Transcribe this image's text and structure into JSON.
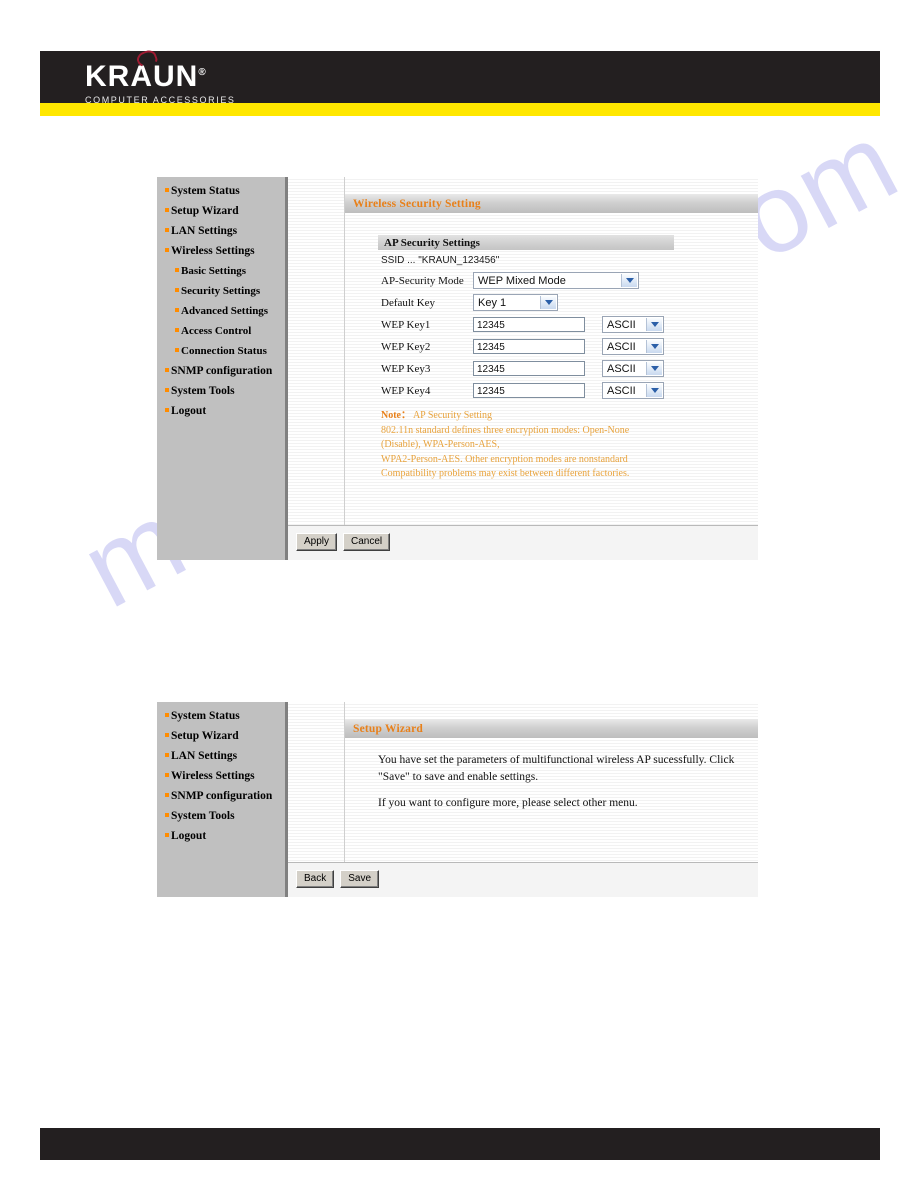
{
  "brand": {
    "logo_text": "KRAUN",
    "logo_registered": "®",
    "tagline": "COMPUTER ACCESSORIES",
    "swirl_icon": "swirl-icon",
    "band_color": "#231f20",
    "accent_color": "#ffe700"
  },
  "watermark": {
    "text": "manualshive.com",
    "color": "#b9b9ef"
  },
  "panel_security": {
    "sidebar": [
      {
        "label": "System Status",
        "sub": false
      },
      {
        "label": "Setup Wizard",
        "sub": false
      },
      {
        "label": "LAN Settings",
        "sub": false
      },
      {
        "label": "Wireless Settings",
        "sub": false
      },
      {
        "label": "Basic Settings",
        "sub": true
      },
      {
        "label": "Security Settings",
        "sub": true
      },
      {
        "label": "Advanced Settings",
        "sub": true
      },
      {
        "label": "Access Control",
        "sub": true
      },
      {
        "label": "Connection Status",
        "sub": true
      },
      {
        "label": "SNMP configuration",
        "sub": false
      },
      {
        "label": "System Tools",
        "sub": false
      },
      {
        "label": "Logout",
        "sub": false
      }
    ],
    "title": "Wireless Security Setting",
    "section_header": "AP Security Settings",
    "ssid_line": "SSID ... \"KRAUN_123456\"",
    "fields": {
      "security_mode_label": "AP-Security Mode",
      "security_mode_value": "WEP Mixed Mode",
      "default_key_label": "Default Key",
      "default_key_value": "Key 1",
      "keys": [
        {
          "label": "WEP Key1",
          "value": "12345",
          "format": "ASCII"
        },
        {
          "label": "WEP Key2",
          "value": "12345",
          "format": "ASCII"
        },
        {
          "label": "WEP Key3",
          "value": "12345",
          "format": "ASCII"
        },
        {
          "label": "WEP Key4",
          "value": "12345",
          "format": "ASCII"
        }
      ]
    },
    "note": {
      "keyword": "Note：",
      "heading": "AP Security Setting",
      "lines": [
        "802.11n standard defines three encryption modes: Open-None",
        "(Disable), WPA-Person-AES,",
        "WPA2-Person-AES. Other encryption modes are nonstandard",
        "Compatibility problems may exist between different factories."
      ]
    },
    "buttons": {
      "apply": "Apply",
      "cancel": "Cancel"
    }
  },
  "panel_wizard": {
    "sidebar": [
      {
        "label": "System Status",
        "sub": false
      },
      {
        "label": "Setup Wizard",
        "sub": false
      },
      {
        "label": "LAN Settings",
        "sub": false
      },
      {
        "label": "Wireless Settings",
        "sub": false
      },
      {
        "label": "SNMP configuration",
        "sub": false
      },
      {
        "label": "System Tools",
        "sub": false
      },
      {
        "label": "Logout",
        "sub": false
      }
    ],
    "title": "Setup Wizard",
    "body": {
      "line1": "You have set the parameters of multifunctional wireless AP sucessfully. Click",
      "line2": "\"Save\" to save and enable settings.",
      "line3": "If you want to configure more, please select other menu."
    },
    "buttons": {
      "back": "Back",
      "save": "Save"
    }
  }
}
